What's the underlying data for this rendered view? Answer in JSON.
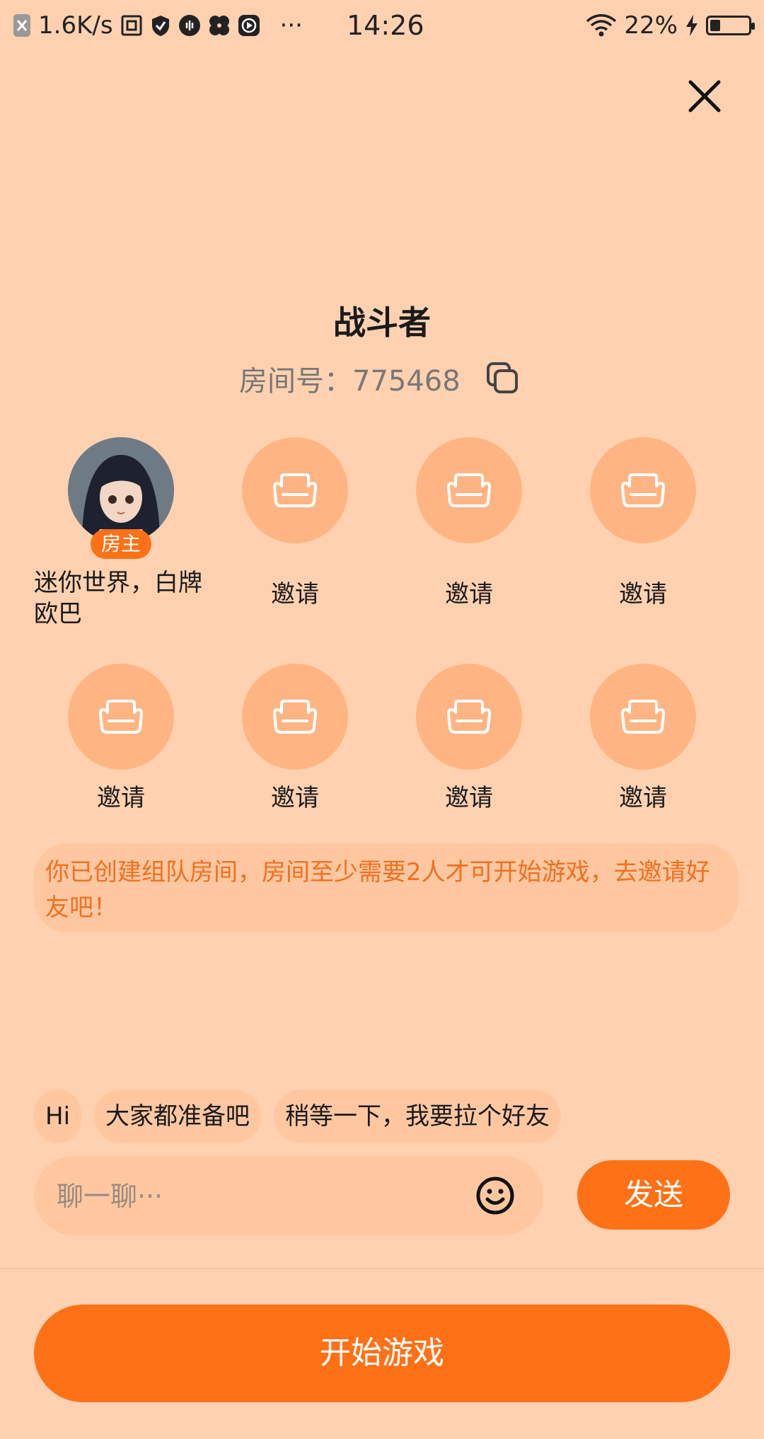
{
  "status_bar": {
    "net_speed": "1.6K/s",
    "time": "14:26",
    "battery": "22%",
    "battery_level": 0.22,
    "more": "···",
    "icons": [
      "app-close-icon",
      "screenshot-icon",
      "shield-icon",
      "voice-icon",
      "fan-icon",
      "play-icon",
      "wifi-icon",
      "charging-icon",
      "battery-icon"
    ]
  },
  "room": {
    "name": "战斗者",
    "id_label": "房间号：775468"
  },
  "host": {
    "badge": "房主",
    "name": "迷你世界，白牌欧巴"
  },
  "seats": [
    {
      "label": "邀请"
    },
    {
      "label": "邀请"
    },
    {
      "label": "邀请"
    },
    {
      "label": "邀请"
    },
    {
      "label": "邀请"
    },
    {
      "label": "邀请"
    },
    {
      "label": "邀请"
    }
  ],
  "notice": "你已创建组队房间，房间至少需要2人才可开始游戏，去邀请好友吧！",
  "quick_replies": [
    "Hi",
    "大家都准备吧",
    "稍等一下，我要拉个好友"
  ],
  "chat": {
    "placeholder": "聊一聊···",
    "send_label": "发送"
  },
  "start_label": "开始游戏",
  "colors": {
    "background": "#FFD1B0",
    "accent": "#FF7117",
    "seat": "#FFB583",
    "notice_text": "#F07020"
  }
}
